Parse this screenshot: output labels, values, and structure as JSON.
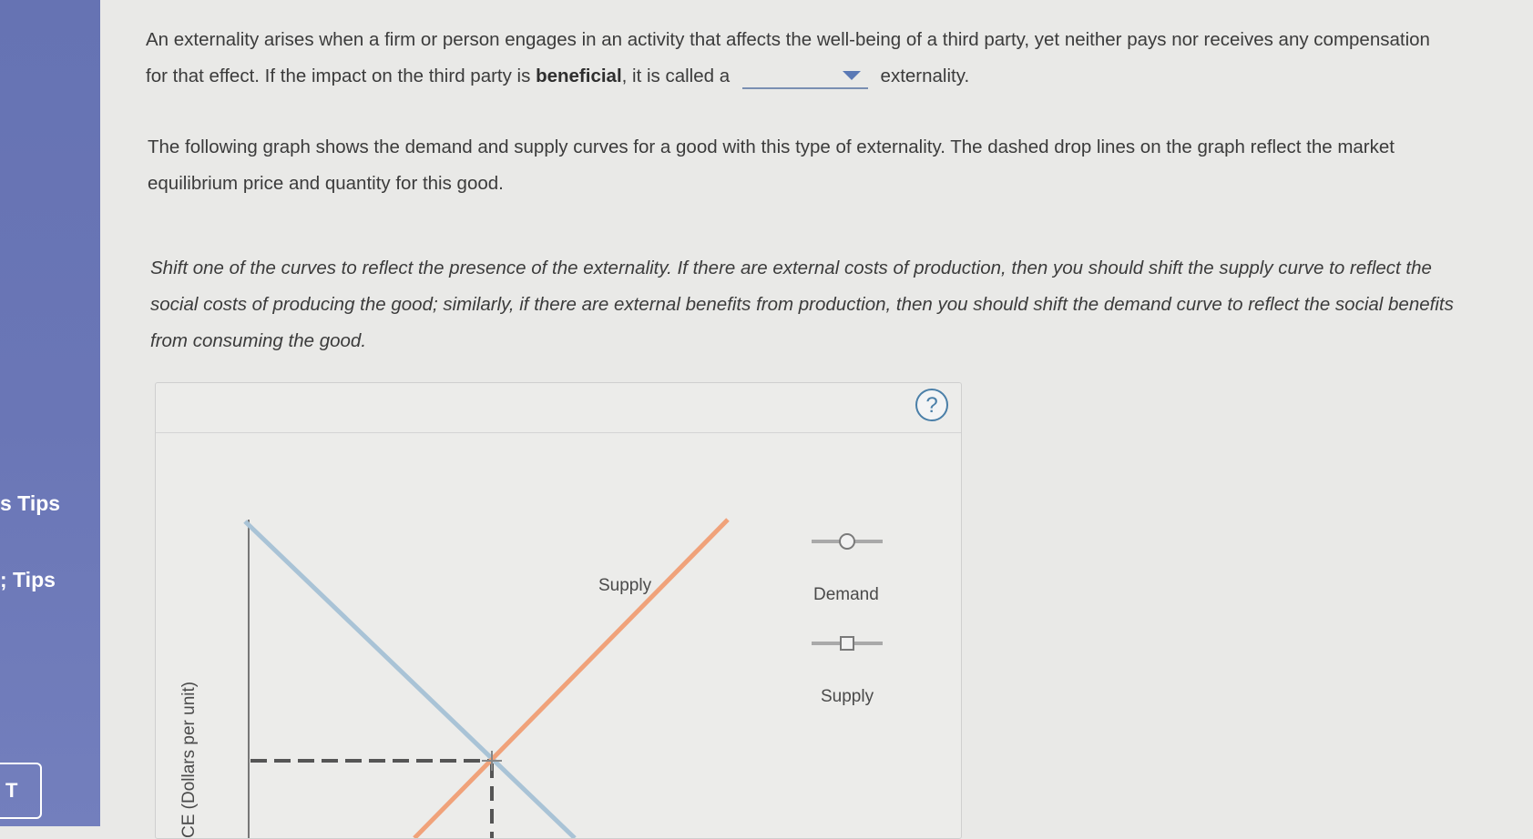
{
  "sidebar": {
    "items": [
      {
        "label": "s Tips"
      },
      {
        "label": "; Tips"
      }
    ],
    "button_label": "T"
  },
  "question": {
    "p1_before": "An externality arises when a firm or person engages in an activity that affects the well-being of a third party, yet neither pays nor receives any compensation for that effect. If the impact on the third party is",
    "p1_bold": "beneficial",
    "p1_mid": ", it is called a",
    "p1_after": "externality.",
    "dropdown_value": "",
    "p2": "The following graph shows the demand and supply curves for a good with this type of externality. The dashed drop lines on the graph reflect the market equilibrium price and quantity for this good.",
    "p3": "Shift one of the curves to reflect the presence of the externality. If there are external costs of production, then you should shift the supply curve to reflect the social costs of producing the good; similarly, if there are external benefits from production, then you should shift the demand curve to reflect the social benefits from consuming the good."
  },
  "graph": {
    "help_label": "?",
    "y_axis_label": "CE (Dollars per unit)",
    "supply_curve_label": "Supply",
    "legend": [
      {
        "label": "Demand",
        "marker": "circle"
      },
      {
        "label": "Supply",
        "marker": "square"
      }
    ],
    "colors": {
      "demand": "#a9c3d6",
      "supply": "#f0a27a",
      "dashed": "#555555"
    }
  }
}
